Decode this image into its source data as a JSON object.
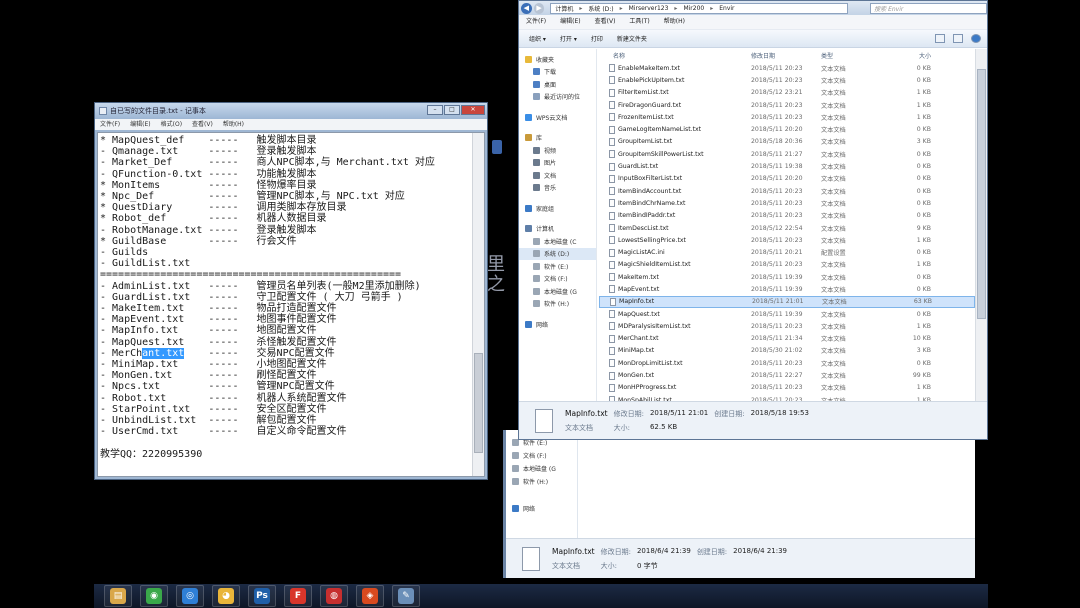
{
  "notepad": {
    "title": "自已写的文件目录.txt - 记事本",
    "menu": [
      "文件(F)",
      "编辑(E)",
      "格式(O)",
      "查看(V)",
      "帮助(H)"
    ],
    "lines_before": "* MapQuest_def    -----   触发脚本目录\n- Qmanage.txt     -----   登录触发脚本\n- Market_Def      -----   商人NPC脚本,与 Merchant.txt 对应\n- QFunction-0.txt -----   功能触发脚本\n* MonItems        -----   怪物爆率目录\n* Npc_Def         -----   管理NPC脚本,与 NPC.txt 对应\n* QuestDiary      -----   调用类脚本存放目录\n* Robot_def       -----   机器人数据目录\n- RobotManage.txt -----   登录触发脚本\n* GuildBase       -----   行会文件\n- Guilds\n- GuildList.txt\n==================================================\n- AdminList.txt   -----   管理员名单列表(一般M2里添加删除)\n- GuardList.txt   -----   守卫配置文件 ( 大刀 弓箭手 )\n- MakeItem.txt    -----   物品打造配置文件\n- MapEvent.txt    -----   地图事件配置文件\n- MapInfo.txt     -----   地图配置文件\n- MapQuest.txt    -----   杀怪触发配置文件\n- MerCh",
    "selected": "ant.txt",
    "lines_after": "    -----   交易NPC配置文件\n- MiniMap.txt     -----   小地图配置文件\n- MonGen.txt      -----   刷怪配置文件\n- Npcs.txt        -----   管理NPC配置文件\n- Robot.txt       -----   机器人系统配置文件\n- StarPoint.txt   -----   安全区配置文件\n- UnbindList.txt  -----   解包配置文件\n- UserCmd.txt     -----   自定义命令配置文件\n\n教学QQ：2220995390"
  },
  "explorer": {
    "address": [
      "计算机",
      "系统 (D:)",
      "Mirserver123",
      "Mir200",
      "Envir"
    ],
    "search_placeholder": "搜索 Envir",
    "menu": [
      "文件(F)",
      "编辑(E)",
      "查看(V)",
      "工具(T)",
      "帮助(H)"
    ],
    "toolbar": {
      "organize": "组织 ▾",
      "open": "打开 ▾",
      "print": "打印",
      "new_folder": "新建文件夹"
    },
    "nav": [
      {
        "label": "收藏夹",
        "color": "#e8b93a",
        "sub": false
      },
      {
        "label": "下载",
        "color": "#4d7fc4",
        "sub": true
      },
      {
        "label": "桌面",
        "color": "#4d7fc4",
        "sub": true
      },
      {
        "label": "最近访问的位",
        "color": "#8aa0bd",
        "sub": true
      },
      {
        "label": "",
        "color": "",
        "sub": false
      },
      {
        "label": "WPS云文档",
        "color": "#3a8ee6",
        "sub": false
      },
      {
        "label": "",
        "color": "",
        "sub": false
      },
      {
        "label": "库",
        "color": "#c99a3a",
        "sub": false
      },
      {
        "label": "视频",
        "color": "#6b7a8d",
        "sub": true
      },
      {
        "label": "图片",
        "color": "#6b7a8d",
        "sub": true
      },
      {
        "label": "文档",
        "color": "#6b7a8d",
        "sub": true
      },
      {
        "label": "音乐",
        "color": "#6b7a8d",
        "sub": true
      },
      {
        "label": "",
        "color": "",
        "sub": false
      },
      {
        "label": "家庭组",
        "color": "#3c7ac6",
        "sub": false
      },
      {
        "label": "",
        "color": "",
        "sub": false
      },
      {
        "label": "计算机",
        "color": "#5f7fa8",
        "sub": false
      },
      {
        "label": "本地磁盘 (C",
        "color": "#9aa6b4",
        "sub": true
      },
      {
        "label": "系统 (D:)",
        "color": "#9aa6b4",
        "sub": true,
        "selected": true
      },
      {
        "label": "软件 (E:)",
        "color": "#9aa6b4",
        "sub": true
      },
      {
        "label": "文档 (F:)",
        "color": "#9aa6b4",
        "sub": true
      },
      {
        "label": "本地磁盘 (G",
        "color": "#9aa6b4",
        "sub": true
      },
      {
        "label": "软件 (H:)",
        "color": "#9aa6b4",
        "sub": true
      },
      {
        "label": "",
        "color": "",
        "sub": false
      },
      {
        "label": "网络",
        "color": "#3c7ac6",
        "sub": false
      }
    ],
    "columns": {
      "name": "名称",
      "date": "修改日期",
      "type": "类型",
      "size": "大小"
    },
    "files": [
      {
        "name": "EnableMakeItem.txt",
        "date": "2018/5/11 20:23",
        "type": "文本文档",
        "size": "0 KB"
      },
      {
        "name": "EnablePickUpItem.txt",
        "date": "2018/5/11 20:23",
        "type": "文本文档",
        "size": "0 KB"
      },
      {
        "name": "FilterItemList.txt",
        "date": "2018/5/12 23:21",
        "type": "文本文档",
        "size": "1 KB"
      },
      {
        "name": "FireDragonGuard.txt",
        "date": "2018/5/11 20:23",
        "type": "文本文档",
        "size": "1 KB"
      },
      {
        "name": "FrozenItemList.txt",
        "date": "2018/5/11 20:23",
        "type": "文本文档",
        "size": "1 KB"
      },
      {
        "name": "GameLogItemNameList.txt",
        "date": "2018/5/11 20:20",
        "type": "文本文档",
        "size": "0 KB"
      },
      {
        "name": "GroupItemList.txt",
        "date": "2018/5/18 20:36",
        "type": "文本文档",
        "size": "3 KB"
      },
      {
        "name": "GroupItemSkillPowerList.txt",
        "date": "2018/5/11 21:27",
        "type": "文本文档",
        "size": "0 KB"
      },
      {
        "name": "GuardList.txt",
        "date": "2018/5/11 19:38",
        "type": "文本文档",
        "size": "0 KB"
      },
      {
        "name": "InputBoxFilterList.txt",
        "date": "2018/5/11 20:20",
        "type": "文本文档",
        "size": "0 KB"
      },
      {
        "name": "ItemBindAccount.txt",
        "date": "2018/5/11 20:23",
        "type": "文本文档",
        "size": "0 KB"
      },
      {
        "name": "ItemBindChrName.txt",
        "date": "2018/5/11 20:23",
        "type": "文本文档",
        "size": "0 KB"
      },
      {
        "name": "ItemBindIPaddr.txt",
        "date": "2018/5/11 20:23",
        "type": "文本文档",
        "size": "0 KB"
      },
      {
        "name": "ItemDescList.txt",
        "date": "2018/5/12 22:54",
        "type": "文本文档",
        "size": "9 KB"
      },
      {
        "name": "LowestSellingPrice.txt",
        "date": "2018/5/11 20:23",
        "type": "文本文档",
        "size": "1 KB"
      },
      {
        "name": "MagicListAC.ini",
        "date": "2018/5/11 20:21",
        "type": "配置设置",
        "size": "0 KB"
      },
      {
        "name": "MagicShieldItemList.txt",
        "date": "2018/5/11 20:23",
        "type": "文本文档",
        "size": "1 KB"
      },
      {
        "name": "MakeItem.txt",
        "date": "2018/5/11 19:39",
        "type": "文本文档",
        "size": "0 KB"
      },
      {
        "name": "MapEvent.txt",
        "date": "2018/5/11 19:39",
        "type": "文本文档",
        "size": "0 KB"
      },
      {
        "name": "MapInfo.txt",
        "date": "2018/5/11 21:01",
        "type": "文本文档",
        "size": "63 KB",
        "highlight": true
      },
      {
        "name": "MapQuest.txt",
        "date": "2018/5/11 19:39",
        "type": "文本文档",
        "size": "0 KB"
      },
      {
        "name": "MDParalysisItemList.txt",
        "date": "2018/5/11 20:23",
        "type": "文本文档",
        "size": "1 KB"
      },
      {
        "name": "MerChant.txt",
        "date": "2018/5/11 21:34",
        "type": "文本文档",
        "size": "10 KB"
      },
      {
        "name": "MiniMap.txt",
        "date": "2018/5/30 21:02",
        "type": "文本文档",
        "size": "3 KB"
      },
      {
        "name": "MonDropLimitList.txt",
        "date": "2018/5/11 20:23",
        "type": "文本文档",
        "size": "0 KB"
      },
      {
        "name": "MonGen.txt",
        "date": "2018/5/11 22:27",
        "type": "文本文档",
        "size": "99 KB"
      },
      {
        "name": "MonHPProgress.txt",
        "date": "2018/5/11 20:23",
        "type": "文本文档",
        "size": "1 KB"
      },
      {
        "name": "MonSpAbilList.txt",
        "date": "2018/5/11 20:23",
        "type": "文本文档",
        "size": "1 KB"
      }
    ],
    "details": {
      "name": "MapInfo.txt",
      "modified_label": "修改日期:",
      "modified": "2018/5/11 21:01",
      "created_label": "创建日期:",
      "created": "2018/5/18 19:53",
      "type": "文本文档",
      "size_label": "大小:",
      "size": "62.5 KB"
    }
  },
  "bg_explorer": {
    "nav": [
      {
        "label": "软件 (E:)",
        "color": "#9aa6b4"
      },
      {
        "label": "文档 (F:)",
        "color": "#9aa6b4"
      },
      {
        "label": "本地磁盘 (G",
        "color": "#9aa6b4"
      },
      {
        "label": "软件 (H:)",
        "color": "#9aa6b4"
      },
      {
        "label": "",
        "color": ""
      },
      {
        "label": "网络",
        "color": "#3c7ac6"
      }
    ],
    "details": {
      "name": "MapInfo.txt",
      "modified_label": "修改日期:",
      "modified": "2018/6/4 21:39",
      "created_label": "创建日期:",
      "created": "2018/6/4 21:39",
      "type": "文本文档",
      "size_label": "大小:",
      "size": "0 字节"
    }
  },
  "desktop_glyph": "里\n之",
  "taskbar": [
    {
      "name": "file-manager-icon",
      "color": "#d9a74a",
      "glyph": "▤"
    },
    {
      "name": "browser-360-icon",
      "color": "#3aa84a",
      "glyph": "◉"
    },
    {
      "name": "baidu-netdisk-icon",
      "color": "#2f7fd6",
      "glyph": "◎"
    },
    {
      "name": "qq-icon",
      "color": "#e9b53a",
      "glyph": "◕"
    },
    {
      "name": "photoshop-icon",
      "color": "#1f5fa8",
      "glyph": "Ps"
    },
    {
      "name": "foxit-reader-icon",
      "color": "#d8362b",
      "glyph": "F"
    },
    {
      "name": "netease-music-icon",
      "color": "#c62f2f",
      "glyph": "◍"
    },
    {
      "name": "game-client-icon",
      "color": "#d84a1f",
      "glyph": "◈"
    },
    {
      "name": "notepad-icon",
      "color": "#6b8fb8",
      "glyph": "✎"
    }
  ]
}
